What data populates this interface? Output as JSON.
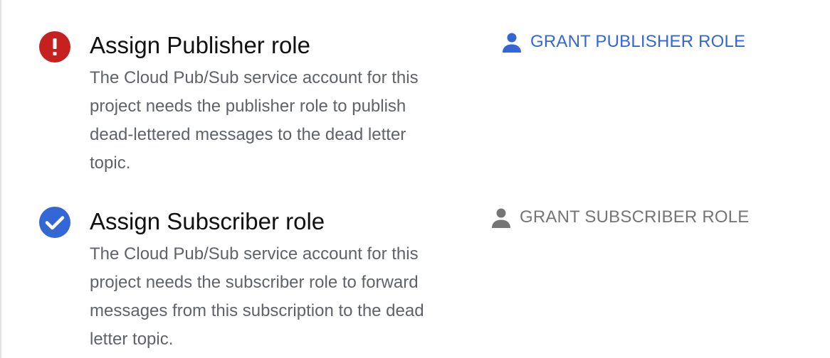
{
  "roles": [
    {
      "status": "error",
      "status_icon": "error-icon",
      "title": "Assign Publisher role",
      "description": "The Cloud Pub/Sub service account for this project needs the publisher role to publish dead-lettered messages to the dead letter topic.",
      "action_label": "GRANT PUBLISHER ROLE",
      "action_icon": "person-icon",
      "action_enabled": true
    },
    {
      "status": "success",
      "status_icon": "check-circle-icon",
      "title": "Assign Subscriber role",
      "description": "The Cloud Pub/Sub service account for this project needs the subscriber role to forward messages from this subscription to the dead letter topic.",
      "action_label": "GRANT SUBSCRIBER ROLE",
      "action_icon": "person-icon",
      "action_enabled": false
    }
  ],
  "colors": {
    "error": "#c5221f",
    "success": "#3367d6",
    "action_active": "#3367d6",
    "action_disabled": "#757575",
    "description_text": "#5f6368"
  }
}
